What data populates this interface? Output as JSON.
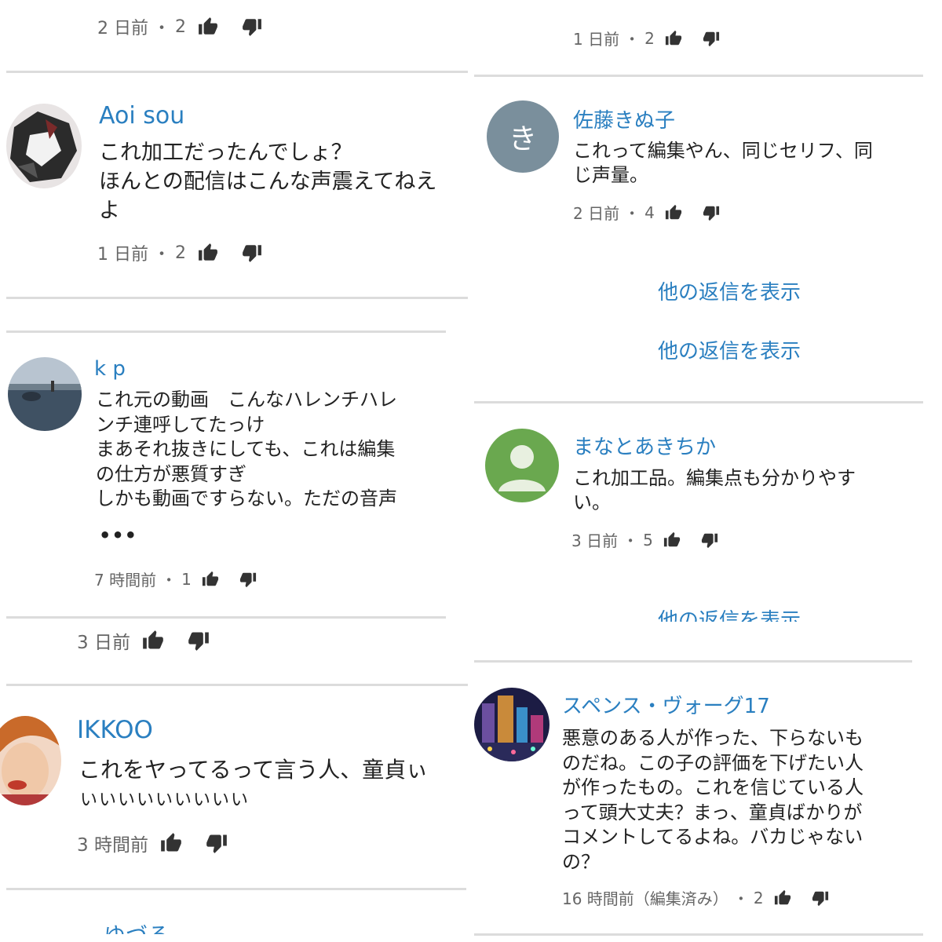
{
  "left_column": {
    "c0": {
      "timestamp": "2 日前",
      "likes": "2"
    },
    "c1": {
      "author": "Aoi sou",
      "text_lines": [
        "これ加工だったんでしょ？",
        "ほんとの配信はこんな声震えてねえ",
        "よ"
      ],
      "timestamp": "1 日前",
      "likes": "2"
    },
    "c2": {
      "author": "k p",
      "text_lines": [
        "これ元の動画　こんなハレンチハレ",
        "ンチ連呼してたっけ",
        "まあそれ抜きにしても、これは編集",
        "の仕方が悪質すぎ",
        "しかも動画ですらない。ただの音声"
      ],
      "ellipsis": "•••",
      "timestamp": "7 時間前",
      "likes": "1"
    },
    "c3": {
      "timestamp": "3 日前"
    },
    "c4": {
      "author": "IKKOO",
      "text_lines": [
        "これをヤってるって言う人、童貞ぃ",
        "いいいいいいいいい"
      ],
      "timestamp": "3 時間前"
    },
    "c5": {
      "author": "ゆづる"
    }
  },
  "right_column": {
    "r0": {
      "timestamp": "1 日前",
      "likes": "2"
    },
    "r1": {
      "author": "佐藤きぬ子",
      "avatar_letter": "き",
      "text_lines": [
        "これって編集やん、同じセリフ、同",
        "じ声量。"
      ],
      "timestamp": "2 日前",
      "likes": "4"
    },
    "show_more_1": "他の返信を表示",
    "show_more_2": "他の返信を表示",
    "r2": {
      "author": "まなとあきちか",
      "text_lines": [
        "これ加工品。編集点も分かりやす",
        "い。"
      ],
      "timestamp": "3 日前",
      "likes": "5"
    },
    "show_more_3": "他の返信を表示",
    "r3": {
      "author": "スペンス・ヴォーグ17",
      "text_lines": [
        "悪意のある人が作った、下らないも",
        "のだね。この子の評価を下げたい人",
        "が作ったもの。これを信じている人",
        "って頭大丈夫？まっ、童貞ばかりが",
        "コメントしてるよね。バカじゃない",
        "の？"
      ],
      "timestamp": "16 時間前（編集済み）",
      "likes": "2"
    }
  },
  "meta_separator": "・",
  "colors": {
    "author_link": "#2a7fc0",
    "meta_gray": "#666666",
    "divider": "#dcdcdc",
    "icon_dark": "#333333",
    "avatar_gray": "#7a8f9c",
    "avatar_green": "#6aa84f"
  },
  "icons": [
    "thumb-up-icon",
    "thumb-down-icon",
    "default-user-icon"
  ]
}
